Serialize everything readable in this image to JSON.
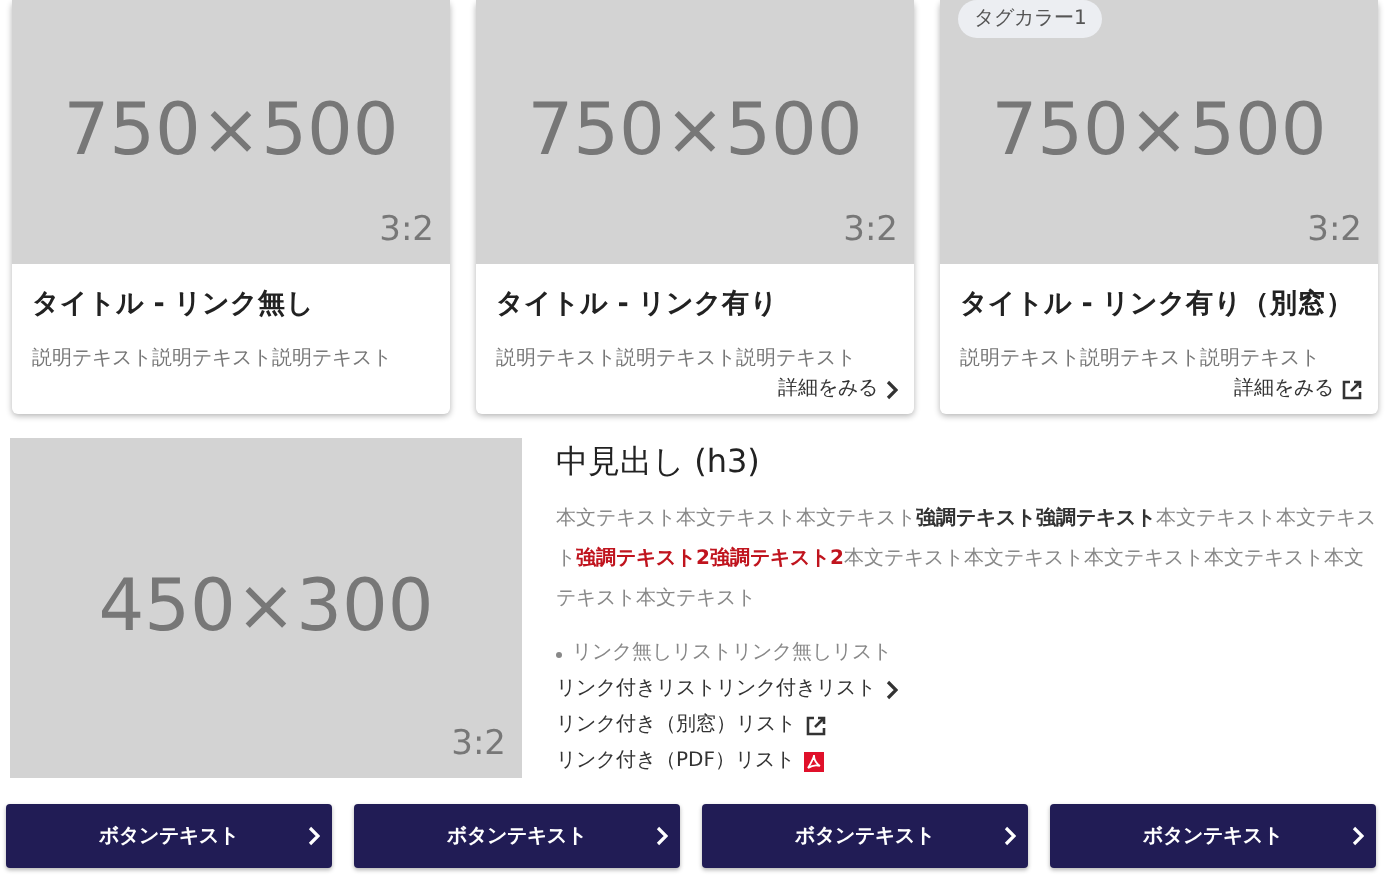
{
  "cards": [
    {
      "image": {
        "size": "750×500",
        "ratio": "3:2"
      },
      "title": "タイトル - リンク無し",
      "description": "説明テキスト説明テキスト説明テキスト"
    },
    {
      "image": {
        "size": "750×500",
        "ratio": "3:2"
      },
      "title": "タイトル - リンク有り",
      "description": "説明テキスト説明テキスト説明テキスト",
      "link": {
        "label": "詳細をみる",
        "kind": "internal"
      }
    },
    {
      "image": {
        "size": "750×500",
        "ratio": "3:2"
      },
      "tag": "タグカラー1",
      "title": "タイトル - リンク有り（別窓）",
      "description": "説明テキスト説明テキスト説明テキスト",
      "link": {
        "label": "詳細をみる",
        "kind": "external"
      }
    }
  ],
  "section": {
    "image": {
      "size": "450×300",
      "ratio": "3:2"
    },
    "heading": "中見出し (h3)",
    "paragraph": [
      {
        "kind": "plain",
        "text": "本文テキスト本文テキスト本文テキスト"
      },
      {
        "kind": "strong",
        "text": "強調テキスト強調テキスト"
      },
      {
        "kind": "plain",
        "text": "本文テキスト本文テキスト"
      },
      {
        "kind": "accent",
        "text": "強調テキスト2強調テキスト2"
      },
      {
        "kind": "plain",
        "text": "本文テキスト本文テキスト本文テキスト本文テキスト本文テキスト本文テキスト"
      }
    ],
    "list": [
      {
        "kind": "plain",
        "text": "リンク無しリストリンク無しリスト"
      },
      {
        "kind": "internal",
        "text": "リンク付きリストリンク付きリスト"
      },
      {
        "kind": "external",
        "text": "リンク付き（別窓）リスト"
      },
      {
        "kind": "pdf",
        "text": "リンク付き（PDF）リスト"
      }
    ]
  },
  "buttons": [
    "ボタンテキスト",
    "ボタンテキスト",
    "ボタンテキスト",
    "ボタンテキスト"
  ]
}
